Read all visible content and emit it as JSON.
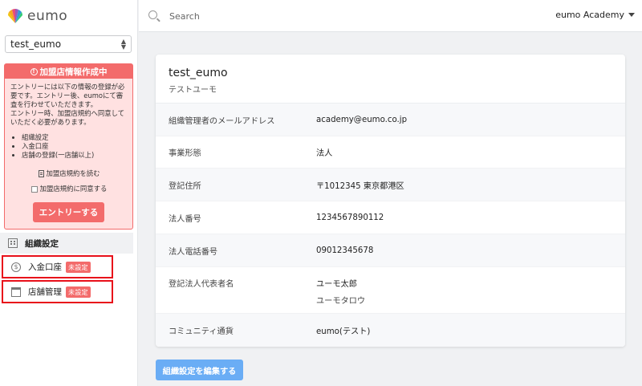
{
  "brand": {
    "name": "eumo"
  },
  "org_select": {
    "value": "test_eumo"
  },
  "alert": {
    "title": "加盟店情報作成中",
    "lines": [
      "エントリーには以下の情報の登録が必",
      "要です。エントリー後、eumoにて審",
      "査を行わせていただきます。",
      "エントリー時、加盟店規約へ同意して",
      "いただく必要があります。"
    ],
    "items": [
      "組織設定",
      "入金口座",
      "店舗の登録(一店舗以上)"
    ],
    "terms_link": "加盟店規約を読む",
    "agree_label": "加盟店規約に同意する",
    "entry_button": "エントリーする"
  },
  "nav": {
    "org_settings": "組織設定",
    "bank_account": "入金口座",
    "store_management": "店舗管理",
    "unset_badge": "未設定"
  },
  "topbar": {
    "search_placeholder": "Search",
    "account": "eumo Academy"
  },
  "card": {
    "title": "test_eumo",
    "subtitle": "テストユーモ",
    "rows": [
      {
        "label": "組織管理者のメールアドレス",
        "value": "academy@eumo.co.jp"
      },
      {
        "label": "事業形態",
        "value": "法人"
      },
      {
        "label": "登記住所",
        "value": "〒1012345 東京都港区"
      },
      {
        "label": "法人番号",
        "value": "1234567890112"
      },
      {
        "label": "法人電話番号",
        "value": "09012345678"
      },
      {
        "label": "登記法人代表者名",
        "value": "ユーモ太郎",
        "value_sub": "ユーモタロウ"
      },
      {
        "label": "コミュニティ通貨",
        "value": "eumo(テスト)"
      }
    ]
  },
  "edit_button": "組織設定を編集する",
  "colors": {
    "alert": "#f36b6b",
    "alert_bg": "#ffe1e1",
    "primary_button": "#6aadf5",
    "highlight_border": "#e8101a"
  }
}
